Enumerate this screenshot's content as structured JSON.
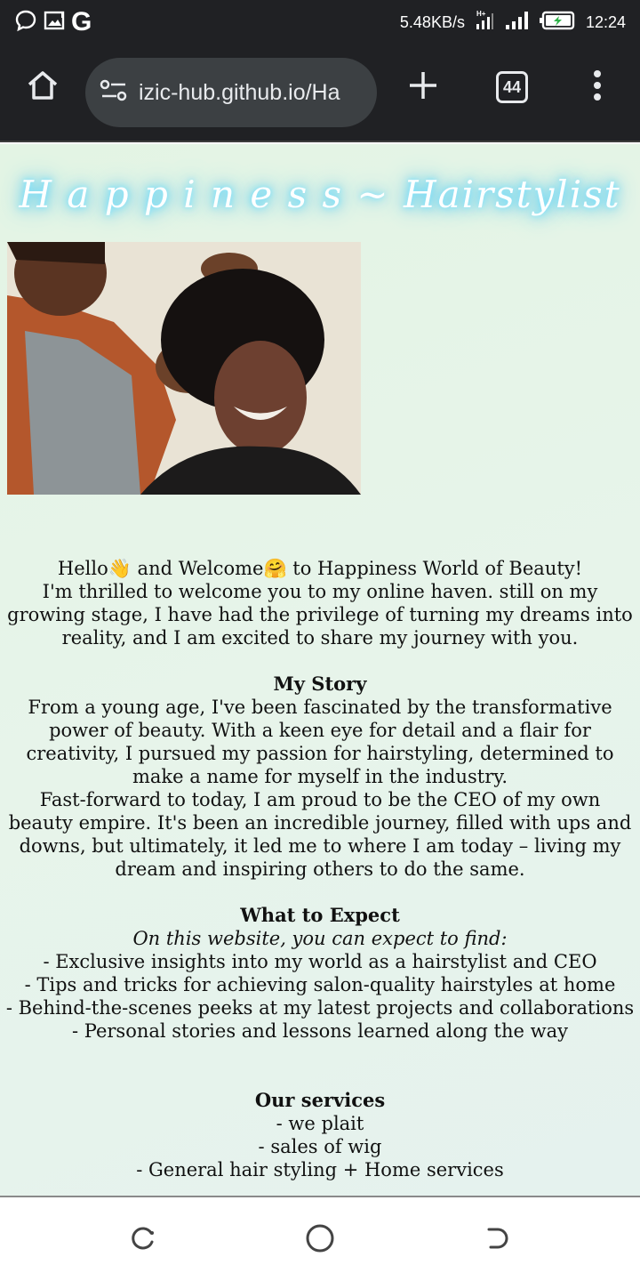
{
  "status_bar": {
    "network_speed": "5.48KB/s",
    "time": "12:24",
    "icons": [
      "chat-bubble-icon",
      "image-icon",
      "google-g-icon",
      "hplus-signal-icon",
      "cell-signal-icon",
      "battery-charging-icon"
    ],
    "g_letter": "G"
  },
  "browser": {
    "url": "izic-hub.github.io/Ha",
    "tab_count": "44"
  },
  "page": {
    "title": "H a p p i n e s s ~ Hairstylist",
    "intro": [
      "Hello👋 and Welcome🤗 to Happiness World of Beauty!",
      "I'm thrilled to welcome you to my online haven. still on my growing stage, I have had the privilege of turning my dreams into reality, and I am excited to share my journey with you."
    ],
    "story": {
      "heading": "My Story",
      "paragraphs": [
        "From a young age, I've been fascinated by the transformative power of beauty. With a keen eye for detail and a flair for creativity, I pursued my passion for hairstyling, determined to make a name for myself in the industry.",
        "Fast-forward to today, I am proud to be the CEO of my own beauty empire. It's been an incredible journey, filled with ups and downs, but ultimately, it led me to where I am today – living my dream and inspiring others to do the same."
      ]
    },
    "expect": {
      "heading": "What to Expect",
      "subheading": "On this website, you can expect to find:",
      "items": [
        "- Exclusive insights into my world as a hairstylist and CEO",
        "- Tips and tricks for achieving salon-quality hairstyles at home",
        "- Behind-the-scenes peeks at my latest projects and collaborations",
        "- Personal stories and lessons learned along the way"
      ]
    },
    "services": {
      "heading": "Our services",
      "items": [
        "- we plait",
        "- sales of wig",
        "- General hair styling + Home services"
      ]
    }
  },
  "colors": {
    "browser_chrome": "#202124",
    "url_pill": "#3c4043",
    "page_background": "#e5f3e8",
    "title_glow": "#46c8f2",
    "text": "#111111"
  }
}
